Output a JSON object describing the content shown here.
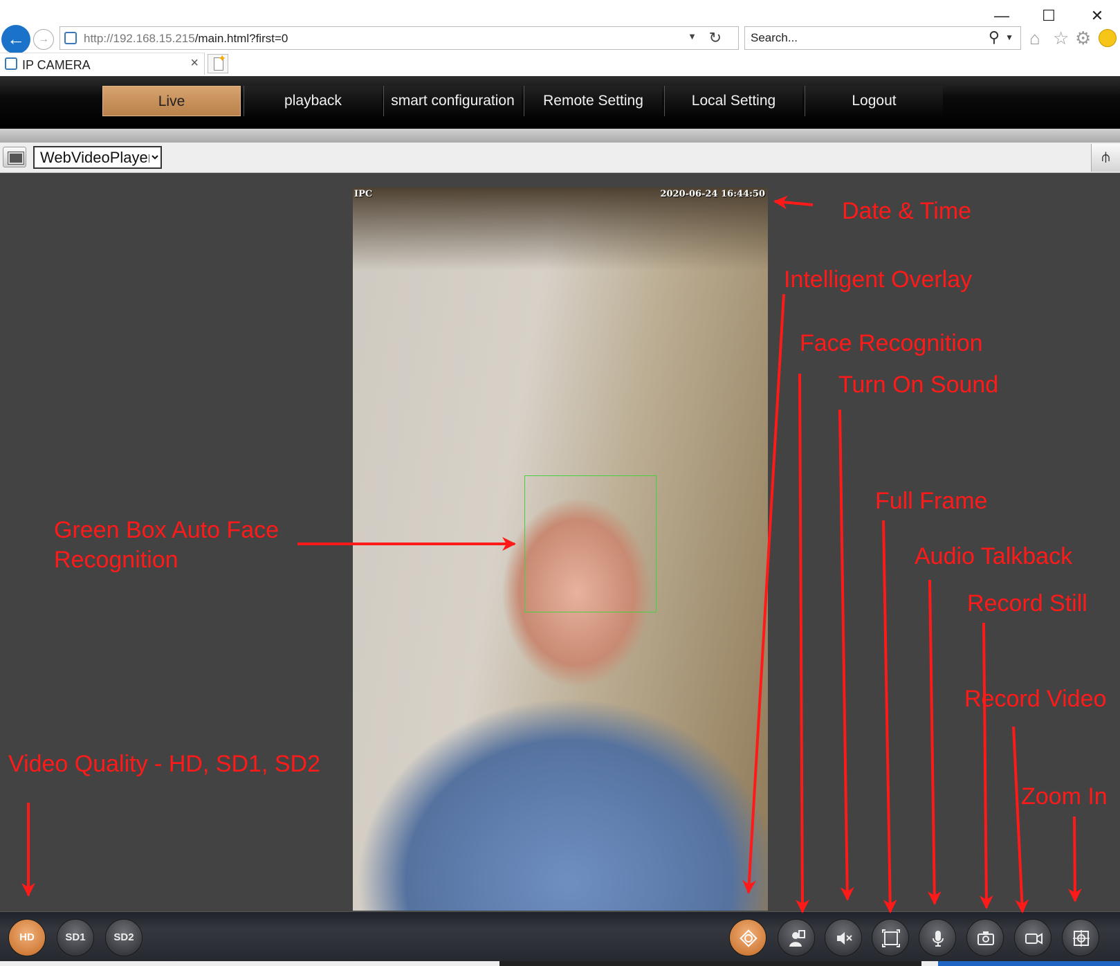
{
  "window": {
    "minimize": "—",
    "maximize": "☐",
    "close": "✕"
  },
  "browser": {
    "url_host": "http://192.168.15.215",
    "url_path": "/main.html?first=0",
    "search_placeholder": "Search...",
    "tab_title": "IP CAMERA",
    "tab_close": "×"
  },
  "nav": {
    "items": [
      {
        "label": "Live",
        "active": true
      },
      {
        "label": "playback"
      },
      {
        "label": "smart configuration"
      },
      {
        "label": "Remote Setting"
      },
      {
        "label": "Local Setting"
      },
      {
        "label": "Logout"
      }
    ]
  },
  "toolbar": {
    "player_selected": "WebVideoPlayer"
  },
  "video": {
    "osd_left": "IPC",
    "osd_datetime": "2020-06-24 16:44:50"
  },
  "annotations": {
    "date_time": "Date & Time",
    "intelligent_overlay": "Intelligent Overlay",
    "face_recognition": "Face Recognition",
    "turn_on_sound": "Turn On Sound",
    "full_frame": "Full Frame",
    "audio_talkback": "Audio Talkback",
    "record_still": "Record Still",
    "record_video": "Record Video",
    "zoom_in": "Zoom In",
    "green_box_line1": "Green Box Auto Face",
    "green_box_line2": "Recognition",
    "video_quality": "Video Quality - HD, SD1, SD2",
    "color": "#ff1a1a"
  },
  "controls": {
    "quality": [
      "HD",
      "SD1",
      "SD2"
    ],
    "active_quality": "HD",
    "accent_color": "#d27f3d"
  }
}
